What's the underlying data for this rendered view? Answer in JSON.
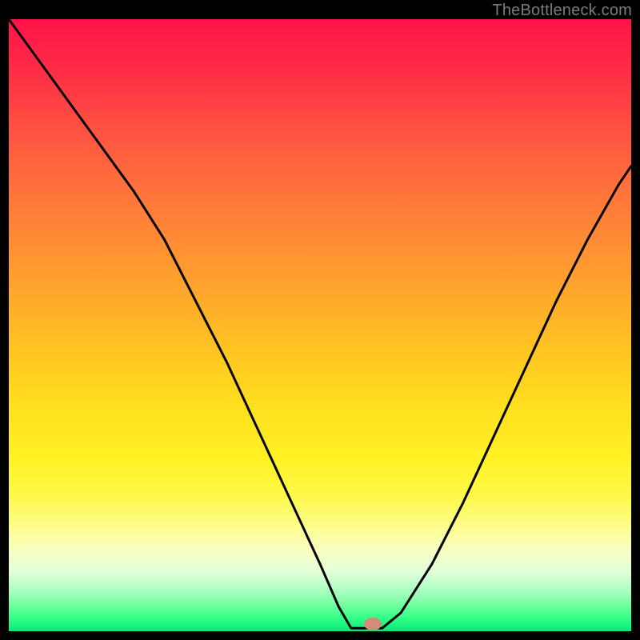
{
  "watermark": "TheBottleneck.com",
  "marker": {
    "x_frac": 0.585,
    "y_frac": 0.988,
    "color": "#d68a7a"
  },
  "chart_data": {
    "type": "line",
    "title": "",
    "xlabel": "",
    "ylabel": "",
    "xlim": [
      0,
      100
    ],
    "ylim": [
      0,
      100
    ],
    "grid": false,
    "legend": false,
    "annotations": [
      "TheBottleneck.com"
    ],
    "series": [
      {
        "name": "bottleneck-curve",
        "x": [
          0,
          5,
          10,
          15,
          20,
          25,
          30,
          35,
          40,
          45,
          50,
          53,
          55,
          57,
          60,
          63,
          68,
          73,
          78,
          83,
          88,
          93,
          98,
          100
        ],
        "y": [
          100,
          93,
          86,
          79,
          72,
          64,
          54,
          44,
          33,
          22,
          11,
          4,
          0.5,
          0.5,
          0.5,
          3,
          11,
          21,
          32,
          43,
          54,
          64,
          73,
          76
        ]
      }
    ],
    "background_gradient": {
      "orientation": "vertical",
      "stops": [
        {
          "pos": 0.0,
          "color": "#ff1348"
        },
        {
          "pos": 0.5,
          "color": "#ffca20"
        },
        {
          "pos": 0.82,
          "color": "#fdfd8e"
        },
        {
          "pos": 1.0,
          "color": "#09e878"
        }
      ]
    },
    "marker_point": {
      "x": 58.5,
      "y": 0.5
    }
  }
}
